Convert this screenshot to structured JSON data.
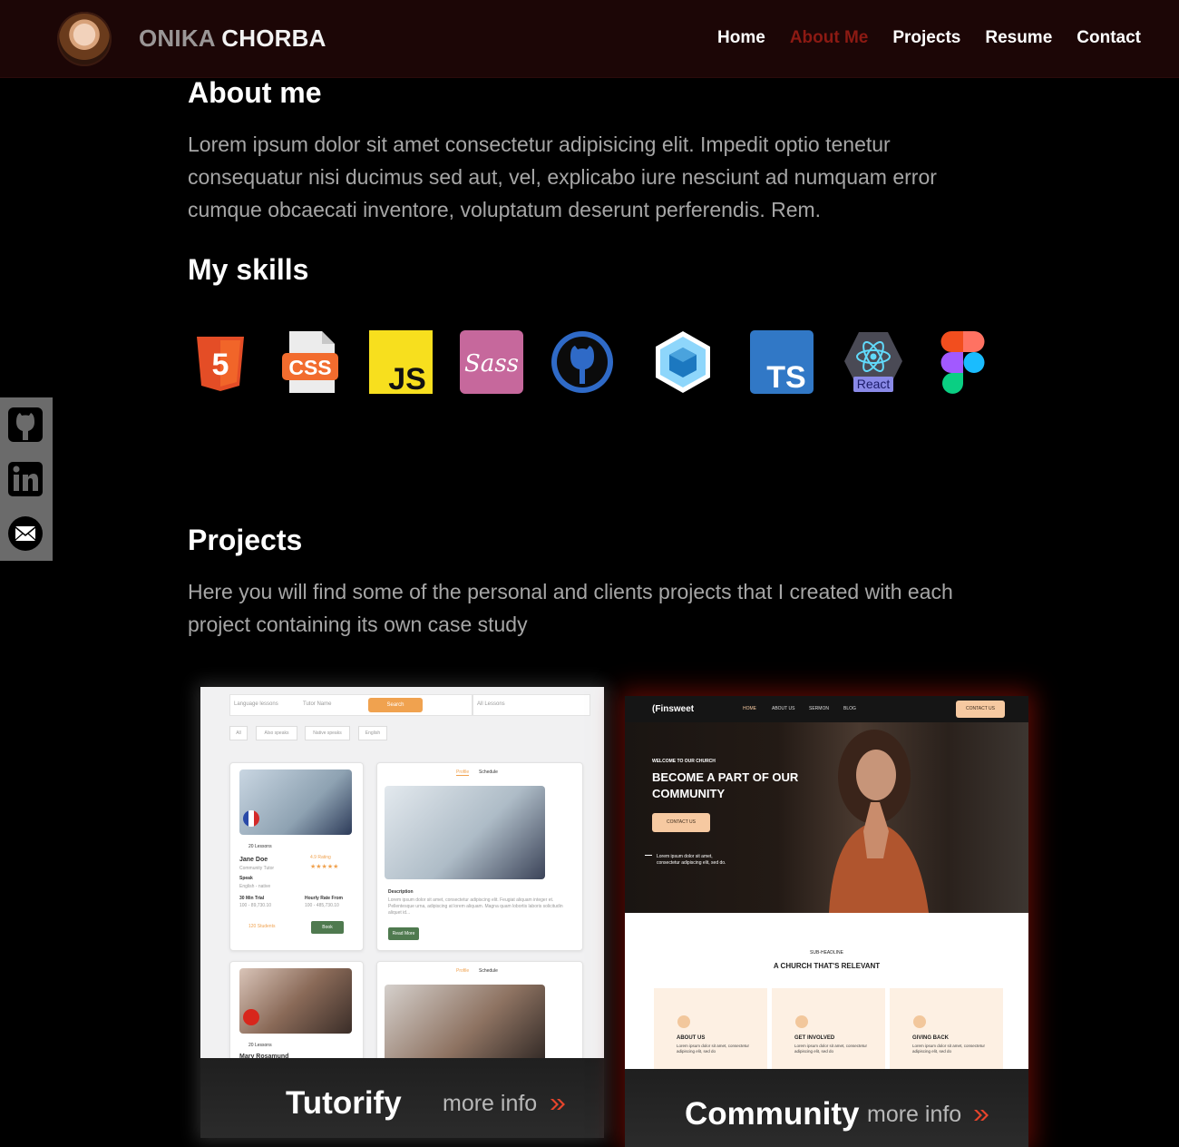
{
  "header": {
    "brand_first": "ONIKA",
    "brand_last": "CHORBA",
    "nav": [
      "Home",
      "About Me",
      "Projects",
      "Resume",
      "Contact"
    ],
    "active_nav": "About Me",
    "active_color": "#8c1a13"
  },
  "about": {
    "title": "About me",
    "text": "Lorem ipsum dolor sit amet consectetur adipisicing elit. Impedit optio tenetur consequatur nisi ducimus sed aut, vel, explicabo iure nesciunt ad numquam error cumque obcaecati inventore, voluptatum deserunt perferendis. Rem."
  },
  "skills": {
    "title": "My skills",
    "items": [
      {
        "icon": "html5-icon",
        "label": "5"
      },
      {
        "icon": "css-icon",
        "label": "CSS"
      },
      {
        "icon": "javascript-icon",
        "label": "JS"
      },
      {
        "icon": "sass-icon",
        "label": "Sass"
      },
      {
        "icon": "github-icon",
        "label": ""
      },
      {
        "icon": "webpack-icon",
        "label": ""
      },
      {
        "icon": "typescript-icon",
        "label": "TS"
      },
      {
        "icon": "react-icon",
        "label": "React"
      },
      {
        "icon": "figma-icon",
        "label": ""
      }
    ]
  },
  "social": [
    "github-icon",
    "linkedin-icon",
    "email-icon"
  ],
  "projects": {
    "title": "Projects",
    "text": "Here you will find some of the personal and clients projects that I created with each project containing its own case study",
    "cards": [
      {
        "title": "Tutorify",
        "more": "more info"
      },
      {
        "title": "Community",
        "more": "more info"
      }
    ]
  },
  "tutorify_preview": {
    "search_placeholder": "Language lessons",
    "tutor_name": "Tutor Name",
    "search_button": "Search",
    "select_value": "All Lessons",
    "chips": [
      "All",
      "Also speaks",
      "Native speaks",
      "English"
    ],
    "lessons": "20 Lessons",
    "rating": "4.9 Rating",
    "tutor_1": "Jane Doe",
    "tutor_1_sub": "Community Tutor",
    "speaks": "Speak",
    "speaks_value": "English - native",
    "trial": "30 Min Trial",
    "trial_price": "100 - 89,730.10",
    "hourly": "Hourly Rate From",
    "hourly_price": "100 - 485,730.10",
    "students": "120 Students",
    "book": "Book",
    "profile_tab": "Profile",
    "schedule_tab": "Schedule",
    "description": "Description",
    "description_text": "Lorem ipsum dolor sit amet, consectetur adipiscing elit. Feugiat aliquam integer et. Pellentesque urna, adipiscing at lorem aliquam. Magna quam lobortis laboris solicitudin aliquet id...",
    "read_more": "Read More",
    "tutor_2": "Mary Rosamund"
  },
  "community_preview": {
    "logo": "Finsweet",
    "nav": [
      "HOME",
      "ABOUT US",
      "SERMON",
      "BLOG"
    ],
    "contact": "CONTACT US",
    "welcome": "WELCOME TO OUR CHURCH",
    "headline_1": "BECOME A PART OF OUR",
    "headline_2": "COMMUNITY",
    "hero_button": "CONTACT US",
    "hero_text": "Lorem ipsum dolor sit amet, consectetur adipiscing elit, sed do.",
    "subheadline": "SUB-HEADLINE",
    "section_title": "A CHURCH THAT'S RELEVANT",
    "boxes": [
      {
        "title": "ABOUT US",
        "text": "Lorem ipsum dolor sit amet, consectetur adipiscing elit, sed do"
      },
      {
        "title": "GET INVOLVED",
        "text": "Lorem ipsum dolor sit amet, consectetur adipiscing elit, sed do"
      },
      {
        "title": "GIVING BACK",
        "text": "Lorem ipsum dolor sit amet, consectetur adipiscing elit, sed do"
      }
    ]
  }
}
